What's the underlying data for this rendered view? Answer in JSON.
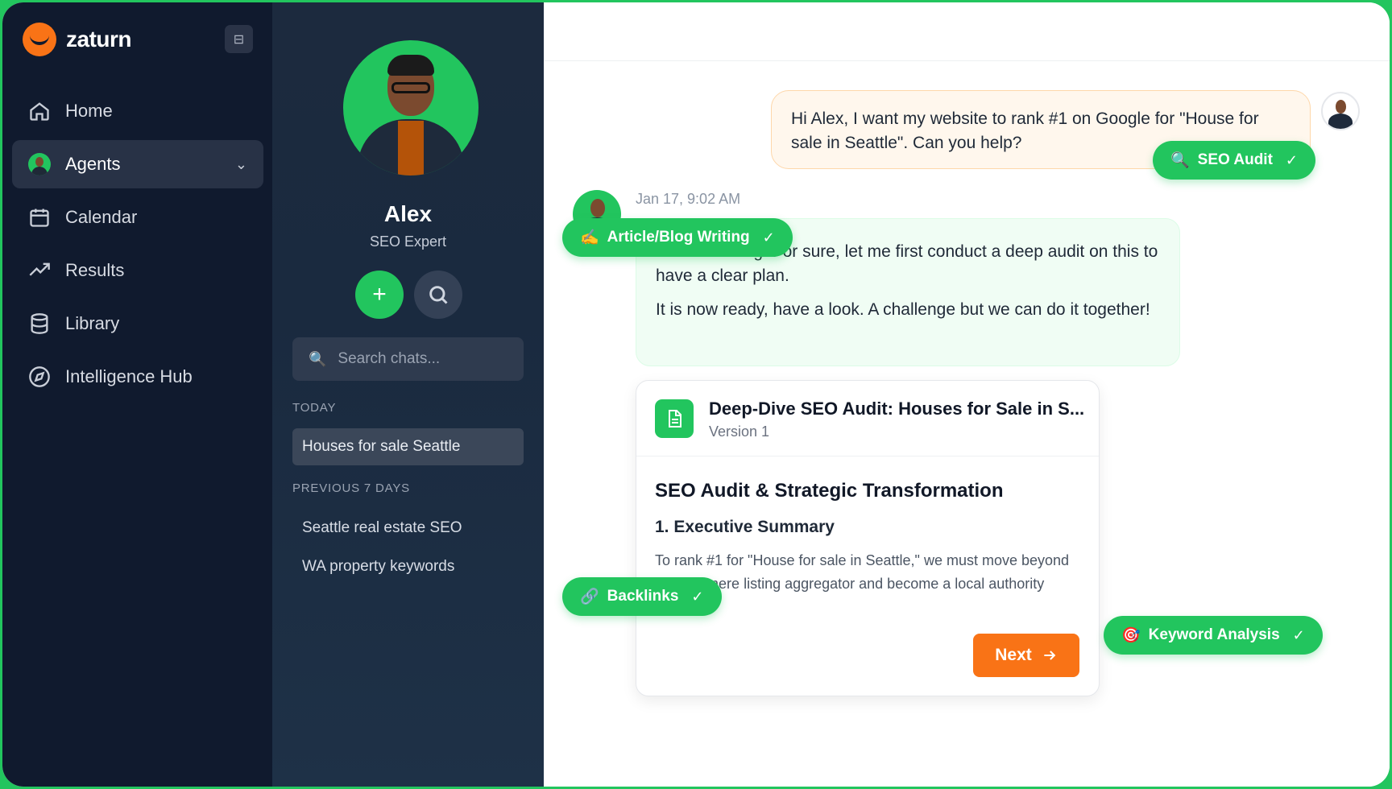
{
  "brand": {
    "name": "zaturn",
    "collapse_icon": "sidebar-collapse-icon",
    "brand_color": "#f97316"
  },
  "nav": {
    "items": [
      {
        "label": "Home",
        "icon": "home-icon"
      },
      {
        "label": "Agents",
        "icon": "agent-avatar"
      },
      {
        "label": "Calendar",
        "icon": "calendar-icon"
      },
      {
        "label": "Results",
        "icon": "trending-up-icon"
      },
      {
        "label": "Library",
        "icon": "database-icon"
      },
      {
        "label": "Intelligence Hub",
        "icon": "compass-icon"
      }
    ],
    "active": "Agents"
  },
  "agent": {
    "name": "Alex",
    "role": "SEO Expert",
    "new_chat": "+",
    "search_placeholder": "Search chats...",
    "sections": {
      "today": "TODAY",
      "previous": "PREVIOUS 7 DAYS"
    },
    "today_chats": [
      "Houses for sale Seattle"
    ],
    "previous_chats": [
      "Seattle real estate SEO",
      "WA property keywords"
    ]
  },
  "conversation": {
    "user_message": "Hi Alex, I want my website to rank #1 on Google for \"House for sale in Seattle\". Can you help?",
    "timestamp": "Jan 17, 9:02 AM",
    "agent_message_1": "Good morning. For sure, let me first conduct a deep audit on this to have a clear plan.",
    "agent_message_2": "It is now ready, have a look. A challenge but we can do it together!"
  },
  "document": {
    "title": "Deep-Dive SEO Audit: Houses for Sale in S...",
    "version": "Version 1",
    "heading": "SEO Audit & Strategic Transformation",
    "subheading": "1. Executive Summary",
    "body": "To rank #1 for \"House for sale in Seattle,\" we must move beyond being a mere listing aggregator and become a local authority hub...",
    "next_label": "Next"
  },
  "chips": {
    "seo_audit": {
      "emoji": "🔍",
      "label": "SEO Audit",
      "check": "✓"
    },
    "article": {
      "emoji": "✍️",
      "label": "Article/Blog Writing",
      "check": "✓"
    },
    "backlinks": {
      "emoji": "🔗",
      "label": "Backlinks",
      "check": "✓"
    },
    "keywords": {
      "emoji": "🎯",
      "label": "Keyword Analysis",
      "check": "✓"
    }
  },
  "colors": {
    "accent_green": "#22c55e",
    "accent_orange": "#f97316",
    "sidebar_bg": "#101a2e"
  }
}
